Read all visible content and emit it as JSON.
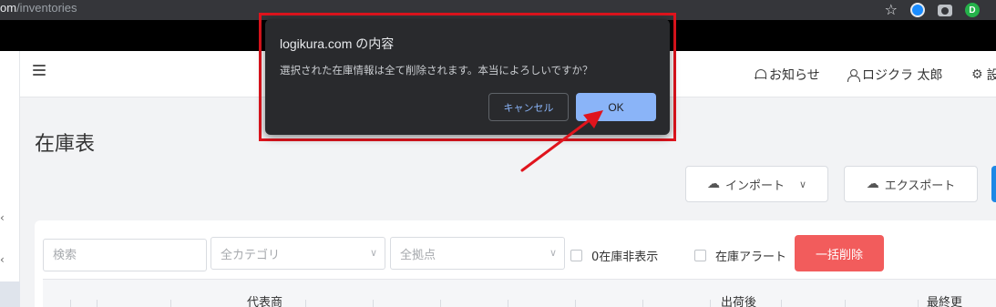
{
  "browser": {
    "url_host": "om",
    "url_path": "/inventories",
    "extension_green_label": "D"
  },
  "header": {
    "notifications_label": "お知らせ",
    "user_label": "ロジクラ 太郎",
    "settings_label": "設"
  },
  "page": {
    "title": "在庫表"
  },
  "toolbar": {
    "import_label": "インポート",
    "export_label": "エクスポート"
  },
  "filters": {
    "search_placeholder": "検索",
    "category_value": "全カテゴリ",
    "location_value": "全拠点",
    "hide_zero_label": "0在庫非表示",
    "stock_alert_label": "在庫アラート",
    "bulk_delete_label": "一括削除"
  },
  "table": {
    "headers": [
      "代表商",
      "出荷後",
      "最終更"
    ]
  },
  "dialog": {
    "title": "logikura.com の内容",
    "message": "選択された在庫情報は全て削除されます。本当によろしいですか？",
    "cancel_label": "キャンセル",
    "ok_label": "OK"
  },
  "colors": {
    "highlight": "#e0141d",
    "danger": "#f25c5c",
    "primary": "#1e88e5",
    "dialog_bg": "#292a2d",
    "dialog_ok": "#8ab4f8"
  }
}
